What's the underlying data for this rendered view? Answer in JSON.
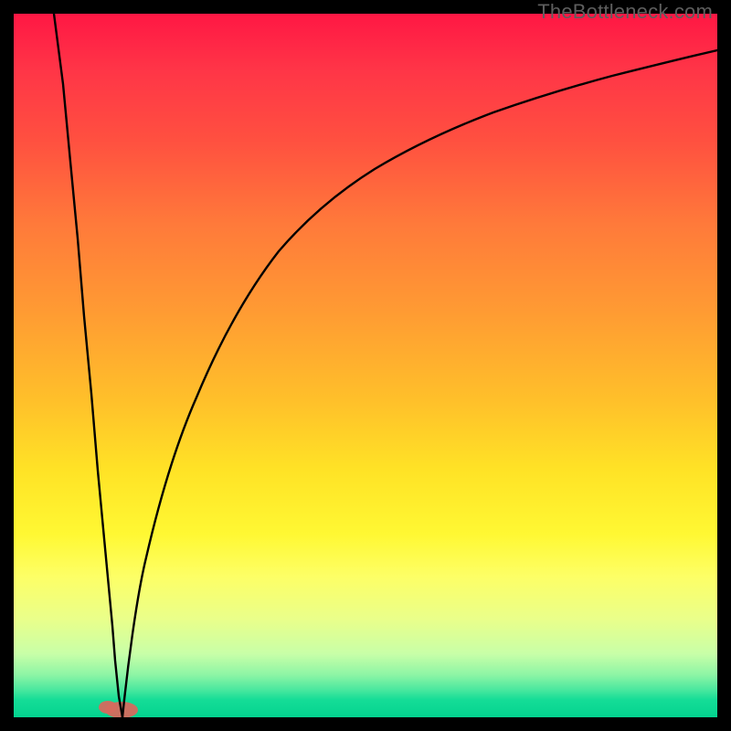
{
  "watermark": "TheBottleneck.com",
  "chart_data": {
    "type": "line",
    "title": "",
    "xlabel": "",
    "ylabel": "",
    "xlim": [
      0,
      100
    ],
    "ylim": [
      0,
      100
    ],
    "grid": false,
    "legend": false,
    "series": [
      {
        "name": "left-branch",
        "x": [
          5.7,
          6.5,
          7.5,
          8.5,
          9.5,
          10.5,
          11.5,
          12.5,
          13.5,
          14.0,
          14.5,
          15.0
        ],
        "values": [
          100,
          90,
          79,
          68,
          57,
          46,
          35,
          24,
          13,
          8,
          3,
          0
        ]
      },
      {
        "name": "right-branch",
        "x": [
          15.0,
          16,
          18,
          20,
          22,
          25,
          28,
          32,
          36,
          40,
          45,
          50,
          55,
          60,
          65,
          70,
          75,
          80,
          85,
          90,
          95,
          100
        ],
        "values": [
          0,
          8,
          22,
          33,
          42,
          52,
          60,
          68,
          73,
          77,
          81,
          84,
          86.5,
          88.5,
          90,
          91.2,
          92.2,
          93,
          93.6,
          94.1,
          94.5,
          94.8
        ]
      }
    ],
    "markers": [
      {
        "name": "trough-blob",
        "x": 15,
        "y": 0.5,
        "color": "#d56a5e"
      }
    ],
    "background_gradient_stops": [
      {
        "pos": 0.0,
        "color": "#ff1744"
      },
      {
        "pos": 0.4,
        "color": "#ff9a33"
      },
      {
        "pos": 0.7,
        "color": "#fff833"
      },
      {
        "pos": 1.0,
        "color": "#03d38f"
      }
    ]
  }
}
